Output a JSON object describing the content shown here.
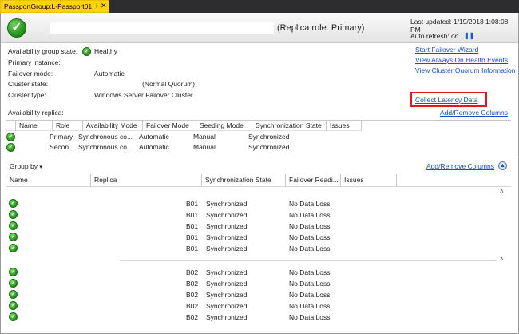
{
  "tab": {
    "title": "PassportGroup:L-Passport01",
    "pin": "⊣",
    "close": "✕"
  },
  "header": {
    "replica_role": "(Replica role: Primary)",
    "last_updated": "Last updated: 1/19/2018 1:08:08 PM",
    "auto_refresh": "Auto refresh: on"
  },
  "summary": {
    "ag_state_label": "Availability group state:",
    "ag_state_value": "Healthy",
    "primary_instance_label": "Primary instance:",
    "failover_mode_label": "Failover mode:",
    "failover_mode_value": "Automatic",
    "cluster_state_label": "Cluster state:",
    "cluster_state_value": "(Normal Quorum)",
    "cluster_type_label": "Cluster type:",
    "cluster_type_value": "Windows Server Failover Cluster"
  },
  "links": {
    "start_failover": "Start Failover Wizard",
    "view_health_events": "View Always On Health Events",
    "view_quorum": "View Cluster Quorum Information",
    "collect_latency": "Collect Latency Data",
    "add_remove_columns_top": "Add/Remove Columns",
    "add_remove_columns_bottom": "Add/Remove Columns"
  },
  "replica_table": {
    "title": "Availability replica:",
    "columns": [
      "Name",
      "Role",
      "Availability Mode",
      "Failover Mode",
      "Seeding Mode",
      "Synchronization State",
      "Issues"
    ],
    "rows": [
      {
        "role": "Primary",
        "availability_mode": "Synchronous co...",
        "failover_mode": "Automatic",
        "seeding_mode": "Manual",
        "sync_state": "Synchronized"
      },
      {
        "role": "Secon...",
        "availability_mode": "Synchronous co...",
        "failover_mode": "Automatic",
        "seeding_mode": "Manual",
        "sync_state": "Synchronized"
      }
    ]
  },
  "database_table": {
    "group_by": "Group by",
    "columns": [
      "Name",
      "Replica",
      "Synchronization State",
      "Failover Readi...",
      "Issues"
    ],
    "groups": [
      {
        "rows": [
          {
            "replica": "B01",
            "sync": "Synchronized",
            "failover": "No Data Loss"
          },
          {
            "replica": "B01",
            "sync": "Synchronized",
            "failover": "No Data Loss"
          },
          {
            "replica": "B01",
            "sync": "Synchronized",
            "failover": "No Data Loss"
          },
          {
            "replica": "B01",
            "sync": "Synchronized",
            "failover": "No Data Loss"
          },
          {
            "replica": "B01",
            "sync": "Synchronized",
            "failover": "No Data Loss"
          }
        ]
      },
      {
        "rows": [
          {
            "replica": "B02",
            "sync": "Synchronized",
            "failover": "No Data Loss"
          },
          {
            "replica": "B02",
            "sync": "Synchronized",
            "failover": "No Data Loss"
          },
          {
            "replica": "B02",
            "sync": "Synchronized",
            "failover": "No Data Loss"
          },
          {
            "replica": "B02",
            "sync": "Synchronized",
            "failover": "No Data Loss"
          },
          {
            "replica": "B02",
            "sync": "Synchronized",
            "failover": "No Data Loss"
          }
        ]
      }
    ]
  },
  "icons": {
    "healthy": "check-circle-icon",
    "pause": "pause-icon",
    "collapse": "collapse-up-icon",
    "dropdown": "caret-down-icon"
  },
  "colors": {
    "tab_active": "#ffd400",
    "link": "#1a4fc0",
    "healthy": "#24931a",
    "highlight": "#e8141b"
  }
}
